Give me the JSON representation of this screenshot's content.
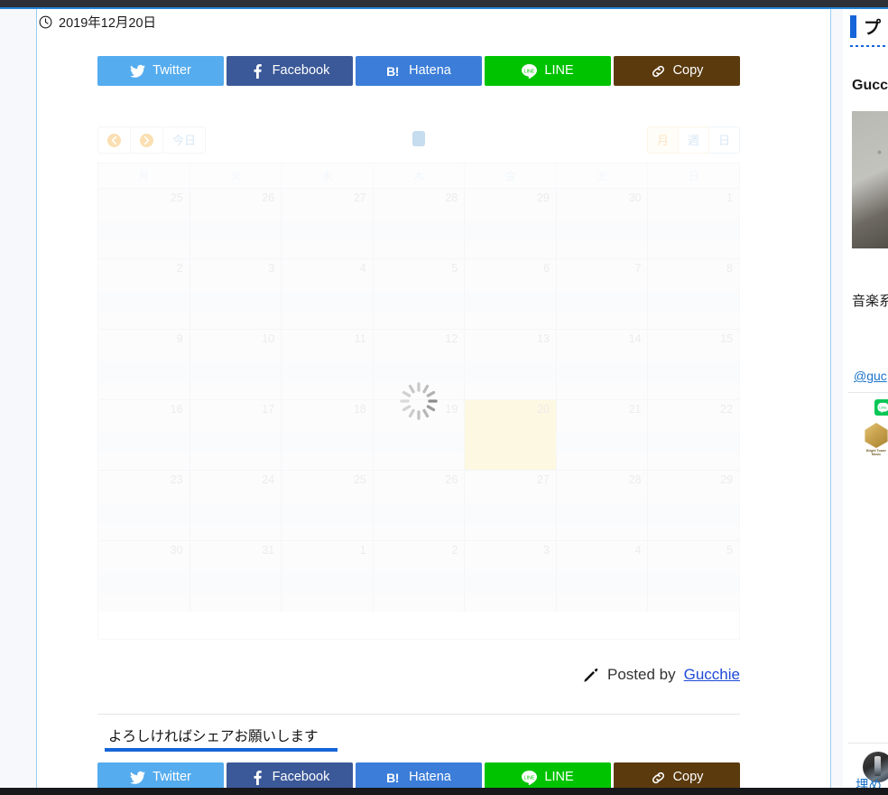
{
  "article": {
    "date_label": "2019年12月20日",
    "date_icon": "clock-icon",
    "posted_by_prefix": "Posted by",
    "author": "Gucchie",
    "author_icon": "pencil-icon"
  },
  "share": {
    "heading": "よろしければシェアお願いします",
    "buttons": [
      {
        "label": "Twitter",
        "icon": "twitter-icon",
        "color": "#55acee"
      },
      {
        "label": "Facebook",
        "icon": "facebook-icon",
        "color": "#3b5998"
      },
      {
        "label": "Hatena",
        "icon": "hatena-icon",
        "color": "#3b7dd8"
      },
      {
        "label": "LINE",
        "icon": "line-icon",
        "color": "#00c300"
      },
      {
        "label": "Copy",
        "icon": "link-icon",
        "color": "#5b3a0e"
      }
    ]
  },
  "calendar": {
    "state": "loading",
    "spinner_icon": "loading-spinner-icon",
    "title": "",
    "nav": {
      "prev_label": "",
      "next_label": "",
      "prev_icon": "chevron-left-icon",
      "next_icon": "chevron-right-icon",
      "today_label": "今日"
    },
    "views": [
      {
        "label": "月",
        "active": true
      },
      {
        "label": "週",
        "active": false
      },
      {
        "label": "日",
        "active": false
      }
    ],
    "day_headers": [
      "月",
      "火",
      "水",
      "木",
      "金",
      "土",
      "日"
    ],
    "today": 20,
    "weeks": [
      [
        {
          "day": 25,
          "other_month": true
        },
        {
          "day": 26,
          "other_month": true
        },
        {
          "day": 27,
          "other_month": true
        },
        {
          "day": 28,
          "other_month": true
        },
        {
          "day": 29,
          "other_month": true
        },
        {
          "day": 30,
          "other_month": true
        },
        {
          "day": 1,
          "other_month": false
        }
      ],
      [
        {
          "day": 2,
          "other_month": false
        },
        {
          "day": 3,
          "other_month": false
        },
        {
          "day": 4,
          "other_month": false
        },
        {
          "day": 5,
          "other_month": false
        },
        {
          "day": 6,
          "other_month": false
        },
        {
          "day": 7,
          "other_month": false
        },
        {
          "day": 8,
          "other_month": false
        }
      ],
      [
        {
          "day": 9,
          "other_month": false
        },
        {
          "day": 10,
          "other_month": false
        },
        {
          "day": 11,
          "other_month": false
        },
        {
          "day": 12,
          "other_month": false
        },
        {
          "day": 13,
          "other_month": false
        },
        {
          "day": 14,
          "other_month": false
        },
        {
          "day": 15,
          "other_month": false
        }
      ],
      [
        {
          "day": 16,
          "other_month": false
        },
        {
          "day": 17,
          "other_month": false
        },
        {
          "day": 18,
          "other_month": false
        },
        {
          "day": 19,
          "other_month": false
        },
        {
          "day": 20,
          "other_month": false,
          "today": true
        },
        {
          "day": 21,
          "other_month": false
        },
        {
          "day": 22,
          "other_month": false
        }
      ],
      [
        {
          "day": 23,
          "other_month": false
        },
        {
          "day": 24,
          "other_month": false
        },
        {
          "day": 25,
          "other_month": false
        },
        {
          "day": 26,
          "other_month": false
        },
        {
          "day": 27,
          "other_month": false
        },
        {
          "day": 28,
          "other_month": false
        },
        {
          "day": 29,
          "other_month": false
        }
      ],
      [
        {
          "day": 30,
          "other_month": false
        },
        {
          "day": 31,
          "other_month": false
        },
        {
          "day": 1,
          "other_month": true
        },
        {
          "day": 2,
          "other_month": true
        },
        {
          "day": 3,
          "other_month": true
        },
        {
          "day": 4,
          "other_month": true
        },
        {
          "day": 5,
          "other_month": true
        }
      ]
    ]
  },
  "sidebar": {
    "widget_title": "プ",
    "profile_name": "Gucch",
    "profile_photo_alt": "profile-photo",
    "bio": "音楽系",
    "handle": "@guc",
    "line_icon": "line-share-icon",
    "brand_icon": "bright-tower-music-logo",
    "brand_name": "Bright Tower\nMusic",
    "avatar_alt": "guitar-avatar",
    "embed_label": "埋め"
  },
  "colors": {
    "accent_blue": "#1565d8",
    "border_blue": "#9ccdf0",
    "page_bg": "#f7f8fc",
    "today_highlight": "#fdf8e1",
    "link": "#1e4bd8"
  }
}
